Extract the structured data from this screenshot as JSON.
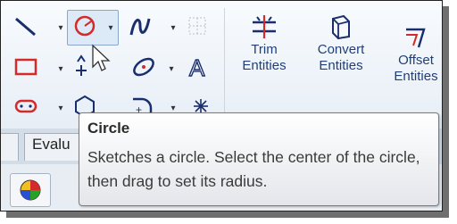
{
  "toolbar": {
    "trim_line1": "Trim",
    "trim_line2": "Entities",
    "convert_line1": "Convert",
    "convert_line2": "Entities",
    "offset_line1": "Offset",
    "offset_line2": "Entities"
  },
  "tabs": {
    "evaluate": "Evalu"
  },
  "tooltip": {
    "title": "Circle",
    "body": "Sketches a circle. Select the center of the circle, then drag to set its radius."
  },
  "colors": {
    "accent_blue": "#1f3f7a",
    "circle_red": "#d42a2a",
    "ribbon_bg": "#eef3f9"
  }
}
